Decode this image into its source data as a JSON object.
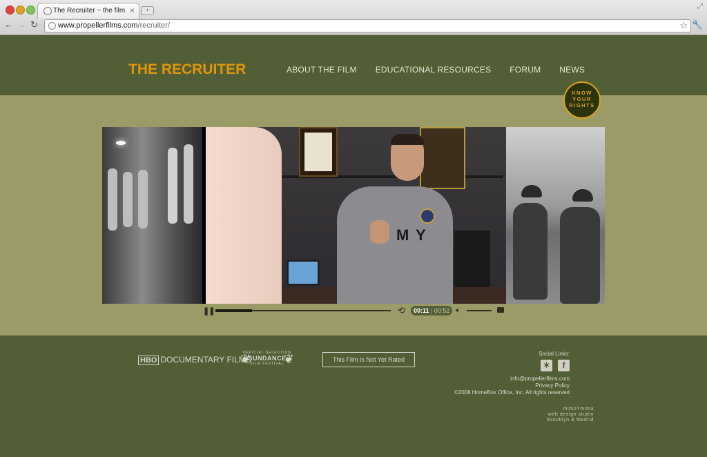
{
  "browser": {
    "tab_title": "The Recruiter ~ the film",
    "tab_close": "×",
    "url_host": "www.propellerfilms.com",
    "url_path": "/recruiter/"
  },
  "site": {
    "logo": "THE RECRUITER",
    "nav": [
      "ABOUT THE FILM",
      "EDUCATIONAL RESOURCES",
      "FORUM",
      "NEWS"
    ],
    "badge": [
      "KNOW",
      "YOUR",
      "RIGHTS"
    ],
    "accent": "#e1960a",
    "bg": "#525e35",
    "stage_bg": "#9a9b66"
  },
  "player": {
    "current_time": "00:11",
    "separator": "|",
    "total_time": "00:52",
    "progress": 0.21,
    "volume": 1.0
  },
  "footer": {
    "hbo_box": "HBO",
    "hbo_text": "DOCUMENTARY FILMS",
    "sundance_small": "OFFICIAL SELECTION",
    "sundance_main": "SUNDANCE",
    "sundance_sub": "FILM FESTIVAL",
    "rating": "This Film Is Not Yet Rated",
    "social_label": "Social Links:",
    "social_icons": [
      "myspace-icon",
      "facebook-icon"
    ],
    "email": "info@propellerfilms.com",
    "privacy": "Privacy Policy",
    "copyright": "©2008 HomeBox Office, Inc. All rights reserved",
    "studio_name": "mimoYmima",
    "studio_line": "web design studio",
    "studio_location": "Brooklyn & Madrid"
  }
}
